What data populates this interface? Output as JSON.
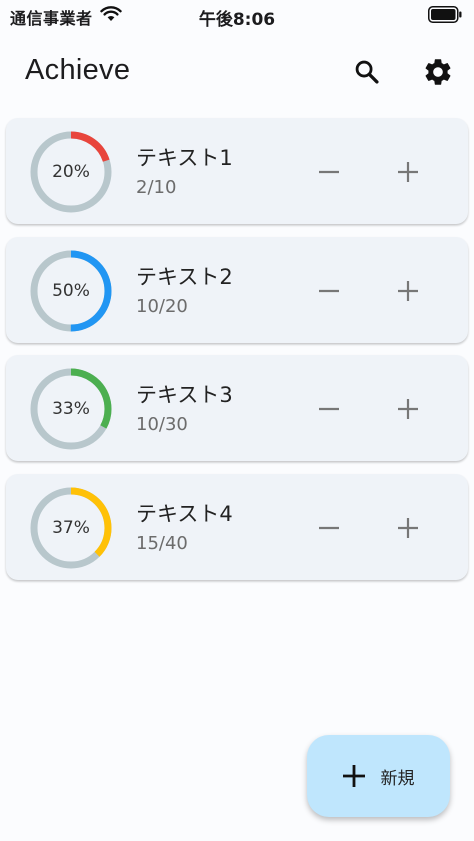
{
  "status_bar": {
    "carrier": "通信事業者",
    "time": "午後8:06"
  },
  "app_bar": {
    "title": "Achieve",
    "icons": [
      "search-icon",
      "gear-icon"
    ]
  },
  "items": [
    {
      "title": "テキスト1",
      "count": "2/10",
      "percent_label": "20%",
      "progress": 0.2,
      "color": "#e8453c"
    },
    {
      "title": "テキスト2",
      "count": "10/20",
      "percent_label": "50%",
      "progress": 0.5,
      "color": "#2196f3"
    },
    {
      "title": "テキスト3",
      "count": "10/30",
      "percent_label": "33%",
      "progress": 0.33,
      "color": "#4caf50"
    },
    {
      "title": "テキスト4",
      "count": "15/40",
      "percent_label": "37%",
      "progress": 0.375,
      "color": "#ffc107"
    }
  ],
  "ring_track_color": "#b8c7cc",
  "fab": {
    "label": "新規",
    "icon": "plus-icon"
  }
}
